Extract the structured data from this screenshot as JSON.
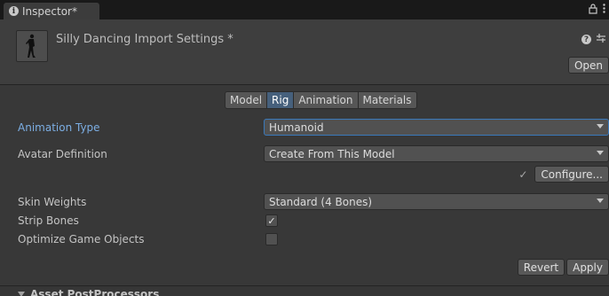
{
  "tab": {
    "title": "Inspector*"
  },
  "header": {
    "title": "Silly Dancing Import Settings *",
    "open_label": "Open"
  },
  "tool_tabs": [
    {
      "label": "Model",
      "active": false
    },
    {
      "label": "Rig",
      "active": true
    },
    {
      "label": "Animation",
      "active": false
    },
    {
      "label": "Materials",
      "active": false
    }
  ],
  "rig": {
    "animation_type_label": "Animation Type",
    "animation_type_value": "Humanoid",
    "avatar_definition_label": "Avatar Definition",
    "avatar_definition_value": "Create From This Model",
    "configure_check": "✓",
    "configure_label": "Configure...",
    "skin_weights_label": "Skin Weights",
    "skin_weights_value": "Standard (4 Bones)",
    "strip_bones_label": "Strip Bones",
    "strip_bones_checked": true,
    "optimize_label": "Optimize Game Objects",
    "optimize_checked": false
  },
  "actions": {
    "revert_label": "Revert",
    "apply_label": "Apply"
  },
  "section": {
    "title": "Asset PostProcessors"
  },
  "colors": {
    "accent": "#7caee3",
    "active_tab": "#46607c",
    "background": "#383838"
  },
  "icons": [
    "info-icon",
    "lock-icon",
    "more-vert-icon",
    "model-thumbnail-icon",
    "help-icon",
    "settings-sliders-icon",
    "dropdown-arrow-icon",
    "check-icon",
    "foldout-triangle-icon"
  ]
}
